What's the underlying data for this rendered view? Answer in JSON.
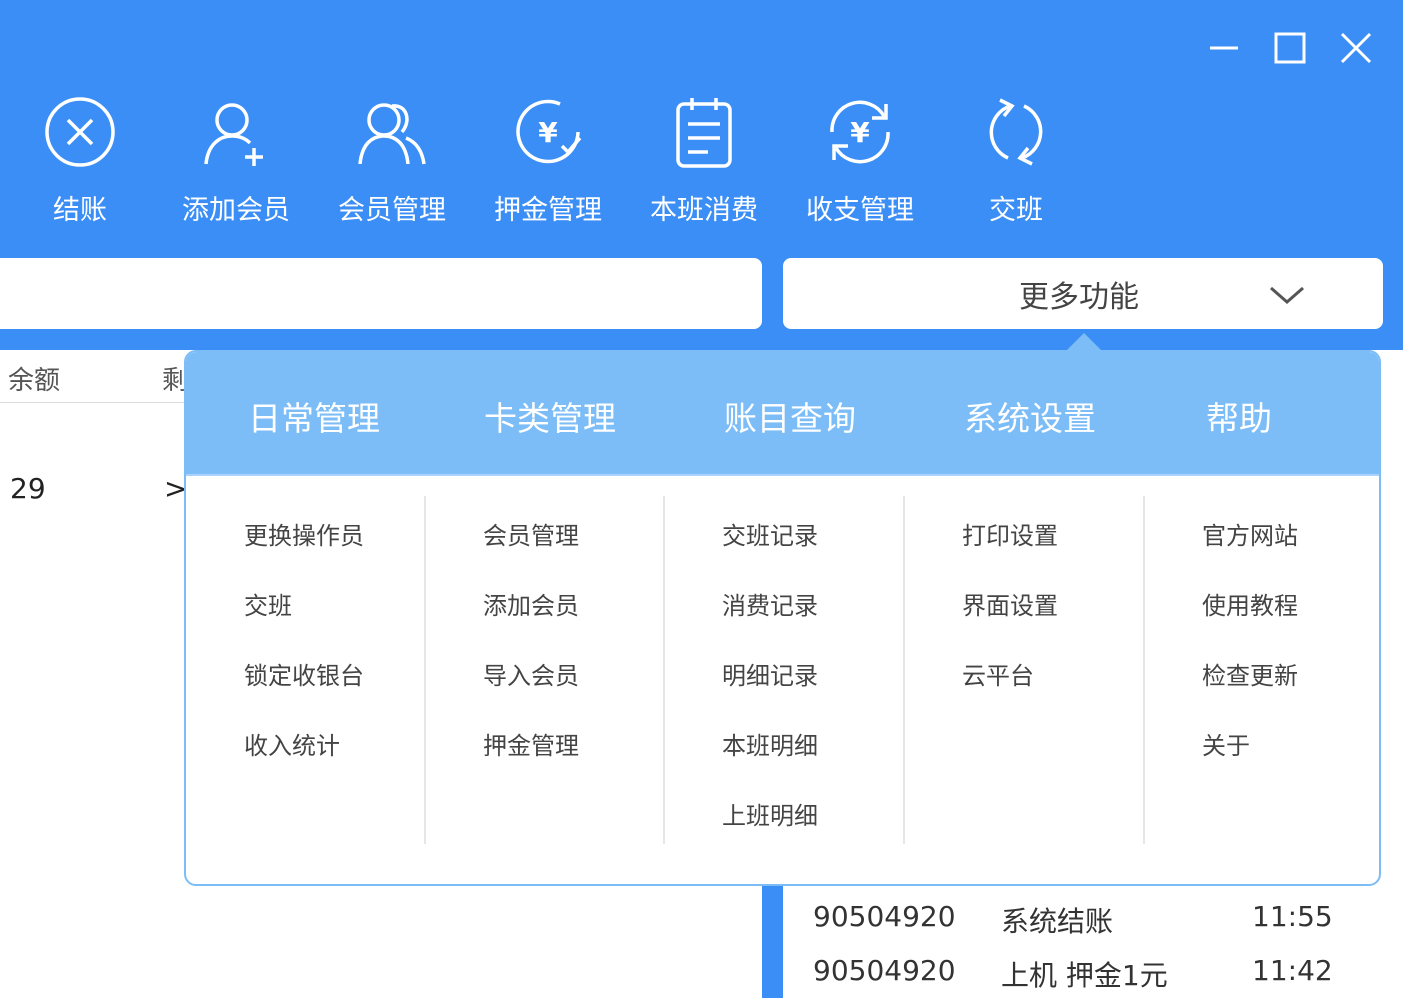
{
  "window": {
    "minimize_icon": "minimize-icon",
    "maximize_icon": "maximize-icon",
    "close_icon": "close-icon"
  },
  "toolbar": [
    {
      "label": "结账",
      "icon": "close-circle-icon"
    },
    {
      "label": "添加会员",
      "icon": "user-add-icon"
    },
    {
      "label": "会员管理",
      "icon": "users-icon"
    },
    {
      "label": "押金管理",
      "icon": "yen-check-icon"
    },
    {
      "label": "本班消费",
      "icon": "clipboard-icon"
    },
    {
      "label": "收支管理",
      "icon": "yen-refresh-icon"
    },
    {
      "label": "交班",
      "icon": "refresh-icon"
    }
  ],
  "search": {
    "value": ""
  },
  "more_functions": {
    "label": "更多功能",
    "icon": "chevron-down-icon"
  },
  "table": {
    "headers": [
      "余额",
      "剩"
    ],
    "row": [
      "29",
      ">"
    ]
  },
  "menu": {
    "categories": [
      "日常管理",
      "卡类管理",
      "账目查询",
      "系统设置",
      "帮助"
    ],
    "columns": [
      [
        "更换操作员",
        "交班",
        "锁定收银台",
        "收入统计"
      ],
      [
        "会员管理",
        "添加会员",
        "导入会员",
        "押金管理"
      ],
      [
        "交班记录",
        "消费记录",
        "明细记录",
        "本班明细",
        "上班明细"
      ],
      [
        "打印设置",
        "界面设置",
        "云平台"
      ],
      [
        "官方网站",
        "使用教程",
        "检查更新",
        "关于"
      ]
    ]
  },
  "records": [
    {
      "id": "90504920",
      "action": "系统结账",
      "time": "11:55"
    },
    {
      "id": "90504920",
      "action": "上机 押金1元",
      "time": "11:42"
    }
  ],
  "colors": {
    "primary": "#3a8ef6",
    "menu_header": "#7dbdf7",
    "white": "#ffffff"
  }
}
